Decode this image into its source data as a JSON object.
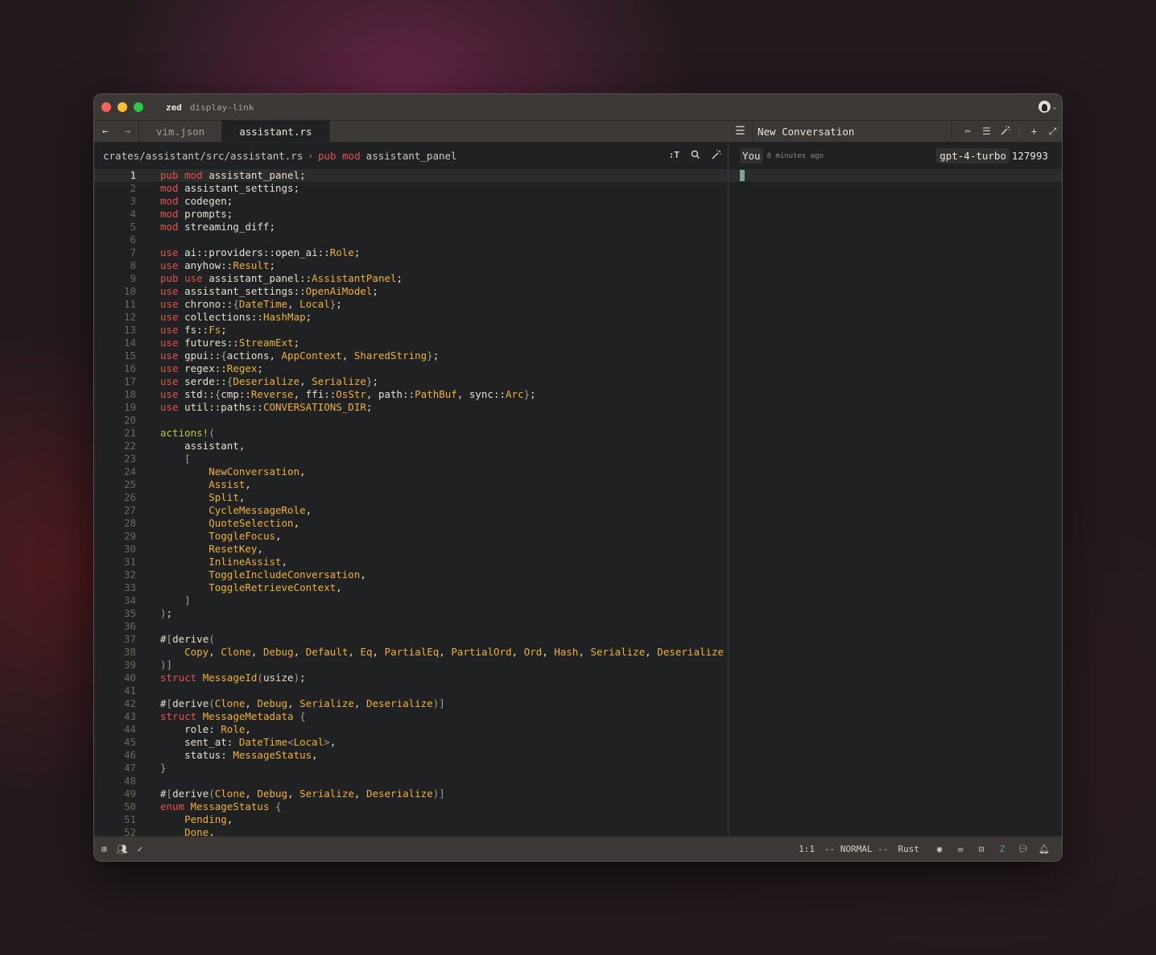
{
  "window": {
    "project": "zed",
    "branch": "display-link"
  },
  "tabs": [
    {
      "label": "vim.json",
      "active": false
    },
    {
      "label": "assistant.rs",
      "active": true
    }
  ],
  "breadcrumb": {
    "path": "crates/assistant/src/assistant.rs",
    "symbol_keyword": "pub mod",
    "symbol_name": "assistant_panel",
    "tools": [
      ":T",
      "search-icon",
      "magic-wand-icon"
    ]
  },
  "colors": {
    "keyword": "#e5534b",
    "type": "#f0b135",
    "macro": "#bfc64a",
    "text": "#e6dfd1",
    "cursor": "#7fa59a"
  },
  "code": {
    "current_line": 1,
    "lines": [
      [
        [
          "k",
          "pub mod"
        ],
        [
          "t",
          " assistant_panel;"
        ]
      ],
      [
        [
          "k",
          "mod"
        ],
        [
          "t",
          " assistant_settings;"
        ]
      ],
      [
        [
          "k",
          "mod"
        ],
        [
          "t",
          " codegen;"
        ]
      ],
      [
        [
          "k",
          "mod"
        ],
        [
          "t",
          " prompts;"
        ]
      ],
      [
        [
          "k",
          "mod"
        ],
        [
          "t",
          " streaming_diff;"
        ]
      ],
      [],
      [
        [
          "k",
          "use"
        ],
        [
          "t",
          " ai::providers::open_ai::"
        ],
        [
          "y",
          "Role"
        ],
        [
          "t",
          ";"
        ]
      ],
      [
        [
          "k",
          "use"
        ],
        [
          "t",
          " anyhow::"
        ],
        [
          "y",
          "Result"
        ],
        [
          "t",
          ";"
        ]
      ],
      [
        [
          "k",
          "pub use"
        ],
        [
          "t",
          " assistant_panel::"
        ],
        [
          "y",
          "AssistantPanel"
        ],
        [
          "t",
          ";"
        ]
      ],
      [
        [
          "k",
          "use"
        ],
        [
          "t",
          " assistant_settings::"
        ],
        [
          "y",
          "OpenAiModel"
        ],
        [
          "t",
          ";"
        ]
      ],
      [
        [
          "k",
          "use"
        ],
        [
          "t",
          " chrono::"
        ],
        [
          "p",
          "{"
        ],
        [
          "y",
          "DateTime"
        ],
        [
          "t",
          ", "
        ],
        [
          "y",
          "Local"
        ],
        [
          "p",
          "}"
        ],
        [
          "t",
          ";"
        ]
      ],
      [
        [
          "k",
          "use"
        ],
        [
          "t",
          " collections::"
        ],
        [
          "y",
          "HashMap"
        ],
        [
          "t",
          ";"
        ]
      ],
      [
        [
          "k",
          "use"
        ],
        [
          "t",
          " fs::"
        ],
        [
          "y",
          "Fs"
        ],
        [
          "t",
          ";"
        ]
      ],
      [
        [
          "k",
          "use"
        ],
        [
          "t",
          " futures::"
        ],
        [
          "y",
          "StreamExt"
        ],
        [
          "t",
          ";"
        ]
      ],
      [
        [
          "k",
          "use"
        ],
        [
          "t",
          " gpui::"
        ],
        [
          "p",
          "{"
        ],
        [
          "t",
          "actions, "
        ],
        [
          "y",
          "AppContext"
        ],
        [
          "t",
          ", "
        ],
        [
          "y",
          "SharedString"
        ],
        [
          "p",
          "}"
        ],
        [
          "t",
          ";"
        ]
      ],
      [
        [
          "k",
          "use"
        ],
        [
          "t",
          " regex::"
        ],
        [
          "y",
          "Regex"
        ],
        [
          "t",
          ";"
        ]
      ],
      [
        [
          "k",
          "use"
        ],
        [
          "t",
          " serde::"
        ],
        [
          "p",
          "{"
        ],
        [
          "y",
          "Deserialize"
        ],
        [
          "t",
          ", "
        ],
        [
          "y",
          "Serialize"
        ],
        [
          "p",
          "}"
        ],
        [
          "t",
          ";"
        ]
      ],
      [
        [
          "k",
          "use"
        ],
        [
          "t",
          " std::"
        ],
        [
          "p",
          "{"
        ],
        [
          "t",
          "cmp::"
        ],
        [
          "y",
          "Reverse"
        ],
        [
          "t",
          ", ffi::"
        ],
        [
          "y",
          "OsStr"
        ],
        [
          "t",
          ", path::"
        ],
        [
          "y",
          "PathBuf"
        ],
        [
          "t",
          ", sync::"
        ],
        [
          "y",
          "Arc"
        ],
        [
          "p",
          "}"
        ],
        [
          "t",
          ";"
        ]
      ],
      [
        [
          "k",
          "use"
        ],
        [
          "t",
          " util::paths::"
        ],
        [
          "y",
          "CONVERSATIONS_DIR"
        ],
        [
          "t",
          ";"
        ]
      ],
      [],
      [
        [
          "m",
          "actions!"
        ],
        [
          "p",
          "("
        ]
      ],
      [
        [
          "t",
          "    assistant,"
        ]
      ],
      [
        [
          "p",
          "    ["
        ]
      ],
      [
        [
          "t",
          "        "
        ],
        [
          "y",
          "NewConversation"
        ],
        [
          "t",
          ","
        ]
      ],
      [
        [
          "t",
          "        "
        ],
        [
          "y",
          "Assist"
        ],
        [
          "t",
          ","
        ]
      ],
      [
        [
          "t",
          "        "
        ],
        [
          "y",
          "Split"
        ],
        [
          "t",
          ","
        ]
      ],
      [
        [
          "t",
          "        "
        ],
        [
          "y",
          "CycleMessageRole"
        ],
        [
          "t",
          ","
        ]
      ],
      [
        [
          "t",
          "        "
        ],
        [
          "y",
          "QuoteSelection"
        ],
        [
          "t",
          ","
        ]
      ],
      [
        [
          "t",
          "        "
        ],
        [
          "y",
          "ToggleFocus"
        ],
        [
          "t",
          ","
        ]
      ],
      [
        [
          "t",
          "        "
        ],
        [
          "y",
          "ResetKey"
        ],
        [
          "t",
          ","
        ]
      ],
      [
        [
          "t",
          "        "
        ],
        [
          "y",
          "InlineAssist"
        ],
        [
          "t",
          ","
        ]
      ],
      [
        [
          "t",
          "        "
        ],
        [
          "y",
          "ToggleIncludeConversation"
        ],
        [
          "t",
          ","
        ]
      ],
      [
        [
          "t",
          "        "
        ],
        [
          "y",
          "ToggleRetrieveContext"
        ],
        [
          "t",
          ","
        ]
      ],
      [
        [
          "p",
          "    ]"
        ]
      ],
      [
        [
          "p",
          ")"
        ],
        [
          "t",
          ";"
        ]
      ],
      [],
      [
        [
          "t",
          "#"
        ],
        [
          "p",
          "["
        ],
        [
          "t",
          "derive"
        ],
        [
          "p",
          "("
        ]
      ],
      [
        [
          "t",
          "    "
        ],
        [
          "y",
          "Copy"
        ],
        [
          "t",
          ", "
        ],
        [
          "y",
          "Clone"
        ],
        [
          "t",
          ", "
        ],
        [
          "y",
          "Debug"
        ],
        [
          "t",
          ", "
        ],
        [
          "y",
          "Default"
        ],
        [
          "t",
          ", "
        ],
        [
          "y",
          "Eq"
        ],
        [
          "t",
          ", "
        ],
        [
          "y",
          "PartialEq"
        ],
        [
          "t",
          ", "
        ],
        [
          "y",
          "PartialOrd"
        ],
        [
          "t",
          ", "
        ],
        [
          "y",
          "Ord"
        ],
        [
          "t",
          ", "
        ],
        [
          "y",
          "Hash"
        ],
        [
          "t",
          ", "
        ],
        [
          "y",
          "Serialize"
        ],
        [
          "t",
          ", "
        ],
        [
          "y",
          "Deserialize"
        ]
      ],
      [
        [
          "p",
          ")]"
        ]
      ],
      [
        [
          "k",
          "struct"
        ],
        [
          "t",
          " "
        ],
        [
          "y",
          "MessageId"
        ],
        [
          "p",
          "("
        ],
        [
          "t",
          "usize"
        ],
        [
          "p",
          ")"
        ],
        [
          "t",
          ";"
        ]
      ],
      [],
      [
        [
          "t",
          "#"
        ],
        [
          "p",
          "["
        ],
        [
          "t",
          "derive"
        ],
        [
          "p",
          "("
        ],
        [
          "y",
          "Clone"
        ],
        [
          "t",
          ", "
        ],
        [
          "y",
          "Debug"
        ],
        [
          "t",
          ", "
        ],
        [
          "y",
          "Serialize"
        ],
        [
          "t",
          ", "
        ],
        [
          "y",
          "Deserialize"
        ],
        [
          "p",
          ")]"
        ]
      ],
      [
        [
          "k",
          "struct"
        ],
        [
          "t",
          " "
        ],
        [
          "y",
          "MessageMetadata"
        ],
        [
          "t",
          " "
        ],
        [
          "p",
          "{"
        ]
      ],
      [
        [
          "t",
          "    role: "
        ],
        [
          "y",
          "Role"
        ],
        [
          "t",
          ","
        ]
      ],
      [
        [
          "t",
          "    sent_at: "
        ],
        [
          "y",
          "DateTime"
        ],
        [
          "p",
          "<"
        ],
        [
          "y",
          "Local"
        ],
        [
          "p",
          ">"
        ],
        [
          "t",
          ","
        ]
      ],
      [
        [
          "t",
          "    status: "
        ],
        [
          "y",
          "MessageStatus"
        ],
        [
          "t",
          ","
        ]
      ],
      [
        [
          "p",
          "}"
        ]
      ],
      [],
      [
        [
          "t",
          "#"
        ],
        [
          "p",
          "["
        ],
        [
          "t",
          "derive"
        ],
        [
          "p",
          "("
        ],
        [
          "y",
          "Clone"
        ],
        [
          "t",
          ", "
        ],
        [
          "y",
          "Debug"
        ],
        [
          "t",
          ", "
        ],
        [
          "y",
          "Serialize"
        ],
        [
          "t",
          ", "
        ],
        [
          "y",
          "Deserialize"
        ],
        [
          "p",
          ")]"
        ]
      ],
      [
        [
          "k",
          "enum"
        ],
        [
          "t",
          " "
        ],
        [
          "y",
          "MessageStatus"
        ],
        [
          "t",
          " "
        ],
        [
          "p",
          "{"
        ]
      ],
      [
        [
          "t",
          "    "
        ],
        [
          "y",
          "Pending"
        ],
        [
          "t",
          ","
        ]
      ],
      [
        [
          "t",
          "    "
        ],
        [
          "y",
          "Done"
        ],
        [
          "t",
          ","
        ]
      ]
    ]
  },
  "assistant": {
    "title": "New Conversation",
    "tools": [
      "scissors-icon",
      "list-icon",
      "magic-wand-icon",
      "plus-icon",
      "maximize-icon"
    ],
    "message": {
      "role": "You",
      "time": "8 minutes ago",
      "model": "gpt-4-turbo",
      "tokens": "127993"
    }
  },
  "statusbar": {
    "position": "1:1",
    "mode": "-- NORMAL --",
    "language": "Rust"
  }
}
